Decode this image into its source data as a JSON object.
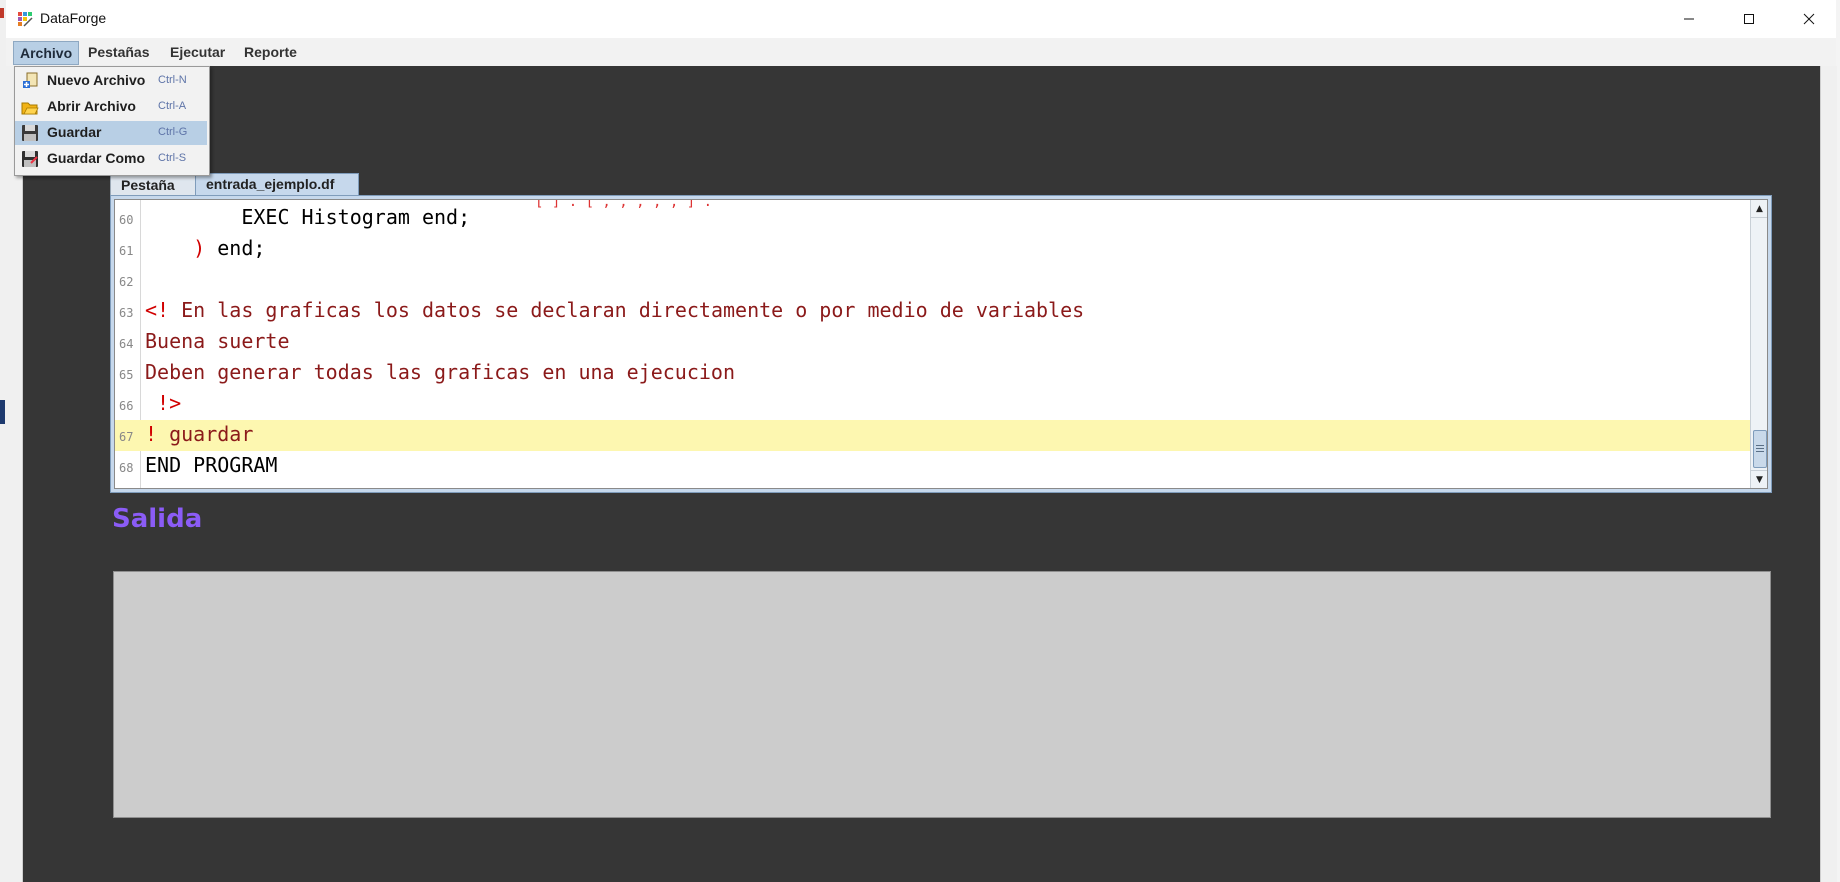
{
  "window": {
    "title": "DataForge"
  },
  "menubar": {
    "items": [
      {
        "label": "Archivo",
        "active": true
      },
      {
        "label": "Pestañas"
      },
      {
        "label": "Ejecutar"
      },
      {
        "label": "Reporte"
      }
    ]
  },
  "file_menu": {
    "items": [
      {
        "label": "Nuevo Archivo",
        "shortcut": "Ctrl-N",
        "icon": "new-file-icon"
      },
      {
        "label": "Abrir Archivo",
        "shortcut": "Ctrl-A",
        "icon": "open-folder-icon"
      },
      {
        "label": "Guardar",
        "shortcut": "Ctrl-G",
        "icon": "floppy-disk-icon",
        "highlighted": true
      },
      {
        "label": "Guardar Como",
        "shortcut": "Ctrl-S",
        "icon": "floppy-disk-save-as-icon"
      }
    ]
  },
  "tabs": [
    {
      "label": "Pestaña"
    },
    {
      "label": "entrada_ejemplo.df",
      "selected": true
    }
  ],
  "editor": {
    "lines": [
      {
        "num": "60",
        "indent": "        ",
        "text": "EXEC Histogram end;"
      },
      {
        "num": "61",
        "indent": "    ",
        "paren": ")",
        "text": " end;"
      },
      {
        "num": "62",
        "text": ""
      },
      {
        "num": "63",
        "comment_open": "<!",
        "text": " En las graficas los datos se declaran directamente o por medio de variables"
      },
      {
        "num": "64",
        "text": "Buena suerte"
      },
      {
        "num": "65",
        "text": "Deben generar todas las graficas en una ejecucion"
      },
      {
        "num": "66",
        "comment_close": " !>"
      },
      {
        "num": "67",
        "comment_open": "!",
        "text": " guardar",
        "highlighted": true
      },
      {
        "num": "68",
        "text": "END PROGRAM"
      }
    ]
  },
  "output": {
    "title": "Salida",
    "content": ""
  },
  "colors": {
    "accent_purple": "#8b5cf6",
    "editor_bg": "#ffffff",
    "highlight_line": "#fdf7b0",
    "app_bg": "#363636",
    "output_bg": "#cccccc"
  }
}
